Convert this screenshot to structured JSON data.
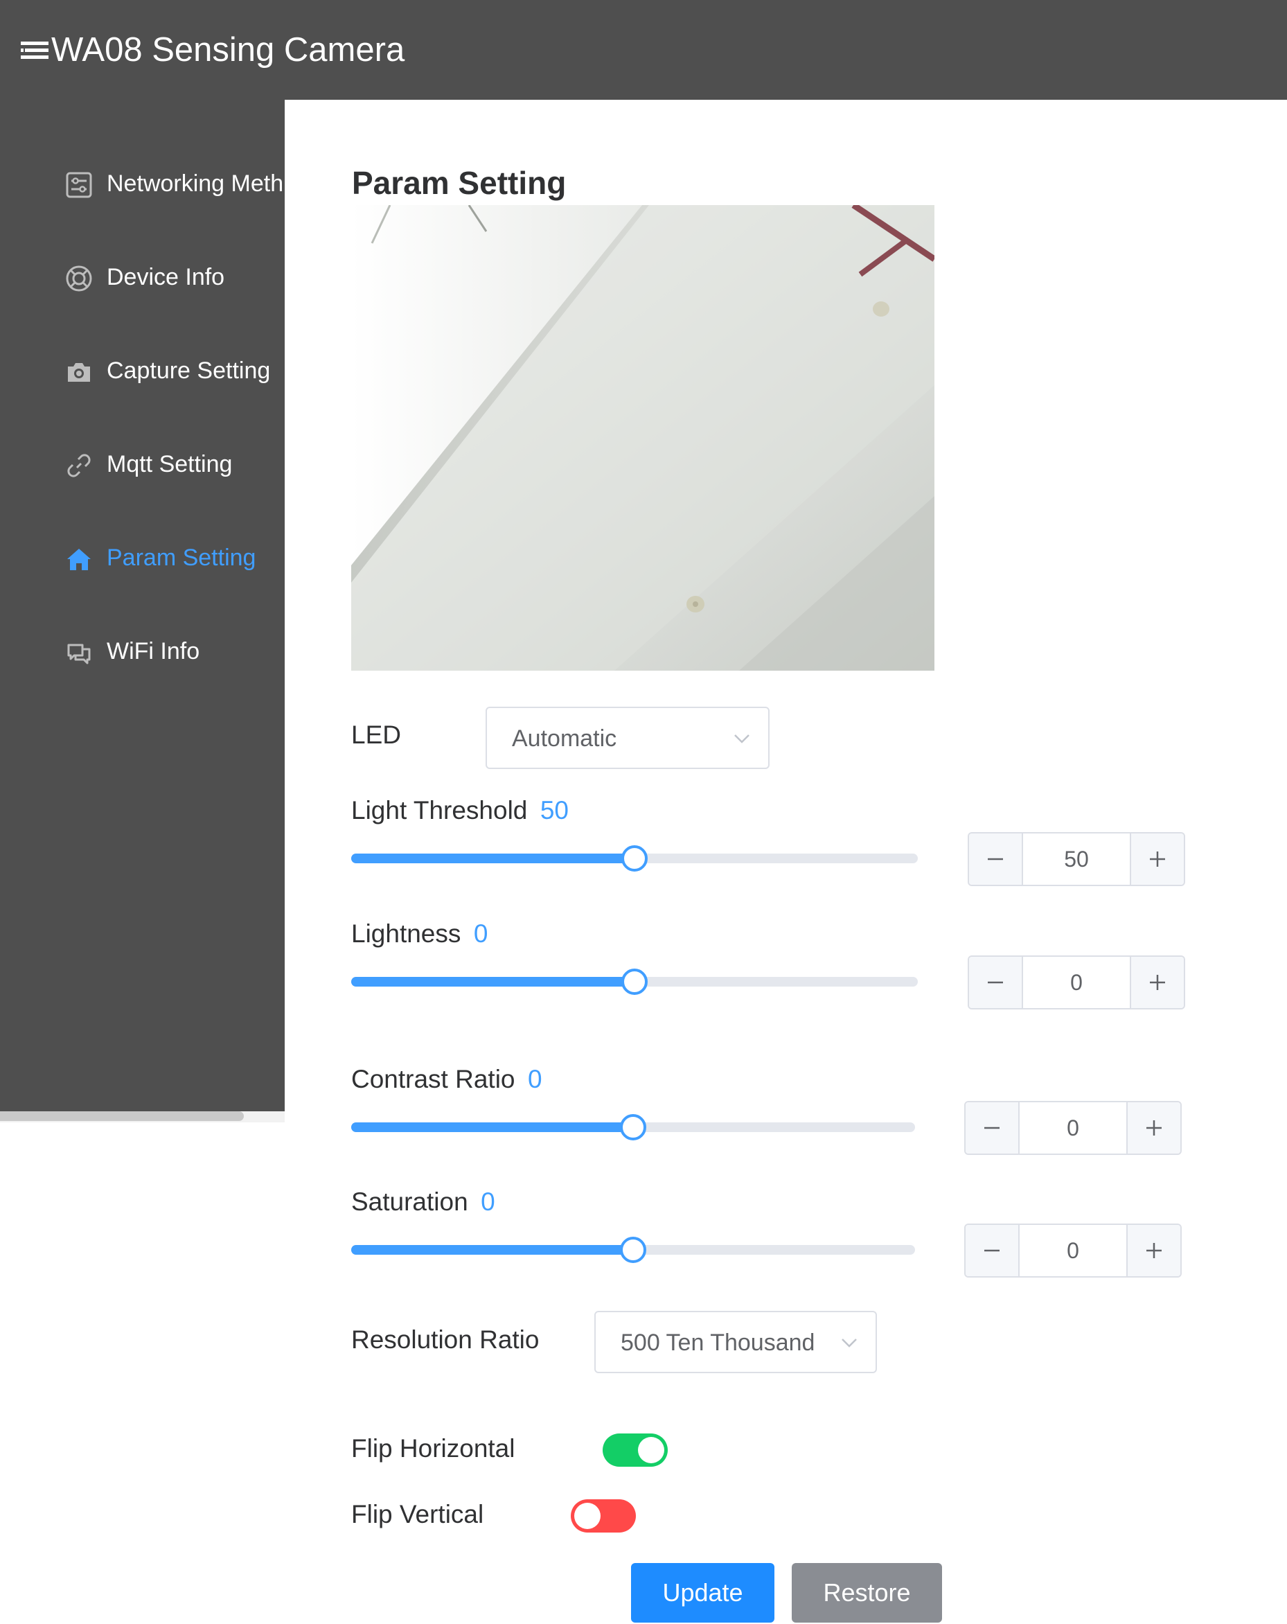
{
  "header": {
    "title": "WA08 Sensing Camera",
    "menu_icon": "hamburger-menu-icon"
  },
  "sidebar": {
    "items": [
      {
        "label": "Networking Meth",
        "icon": "settings-panel-icon",
        "active": false
      },
      {
        "label": "Device Info",
        "icon": "lifebuoy-icon",
        "active": false
      },
      {
        "label": "Capture Setting",
        "icon": "camera-icon",
        "active": false
      },
      {
        "label": "Mqtt Setting",
        "icon": "link-icon",
        "active": false
      },
      {
        "label": "Param Setting",
        "icon": "home-icon",
        "active": true
      },
      {
        "label": "WiFi Info",
        "icon": "chat-bubbles-icon",
        "active": false
      }
    ]
  },
  "main": {
    "title": "Param Setting",
    "led": {
      "label": "LED",
      "value": "Automatic"
    },
    "sliders": [
      {
        "label": "Light Threshold",
        "value": "50",
        "input_value": "50",
        "fill_fraction": 0.5
      },
      {
        "label": "Lightness",
        "value": "0",
        "input_value": "0",
        "fill_fraction": 0.5
      },
      {
        "label": "Contrast Ratio",
        "value": "0",
        "input_value": "0",
        "fill_fraction": 0.5
      },
      {
        "label": "Saturation",
        "value": "0",
        "input_value": "0",
        "fill_fraction": 0.5
      }
    ],
    "resolution": {
      "label": "Resolution Ratio",
      "value": "500 Ten Thousand"
    },
    "flip_horizontal": {
      "label": "Flip Horizontal",
      "on": true
    },
    "flip_vertical": {
      "label": "Flip Vertical",
      "on": false
    },
    "buttons": {
      "update": "Update",
      "restore": "Restore"
    }
  },
  "colors": {
    "header_bg": "#4f4f4f",
    "accent": "#409eff",
    "switch_on": "#13ce66",
    "switch_off": "#ff4949",
    "update_button": "#1e8cff",
    "restore_button": "#8a8d93"
  }
}
